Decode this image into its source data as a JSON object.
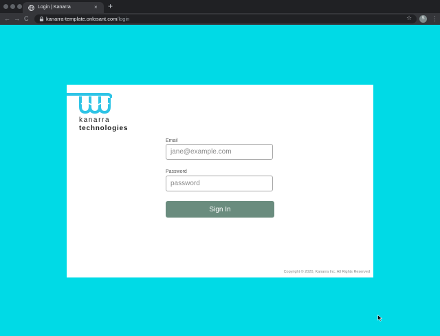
{
  "browser": {
    "tab": {
      "title": "Login | Kanarra",
      "close": "×"
    },
    "new_tab": "+",
    "nav": {
      "back": "←",
      "forward": "→",
      "reload": "C"
    },
    "address": {
      "host": "kanarra-template.onlosant.com",
      "path": "/login"
    },
    "bookmark_star": "☆",
    "profile_initial": "S",
    "menu": "⋮"
  },
  "logo": {
    "line1": "kanarra",
    "line2": "technologies",
    "color": "#2ec4e6"
  },
  "form": {
    "email_label": "Email",
    "email_placeholder": "jane@example.com",
    "password_label": "Password",
    "password_placeholder": "password",
    "submit_label": "Sign In"
  },
  "footer": {
    "copyright": "Copyright © 2020, Kanarra Inc. All Rights Reserved"
  },
  "colors": {
    "background": "#00dae6",
    "button": "#6a8c7e",
    "card": "#ffffff"
  }
}
